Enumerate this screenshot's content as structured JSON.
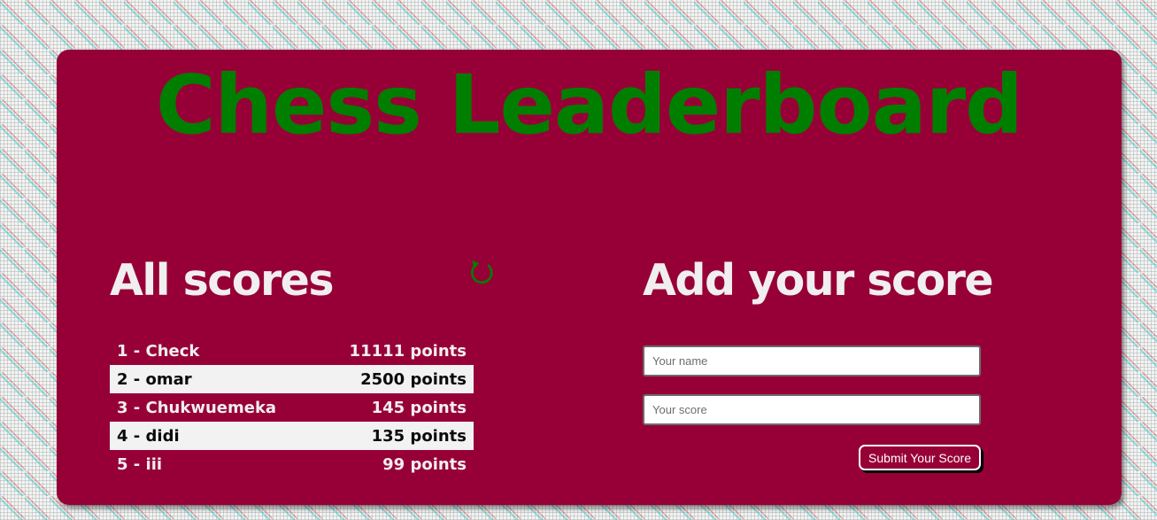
{
  "page": {
    "title": "Chess Leaderboard"
  },
  "scores": {
    "heading": "All scores",
    "refresh_icon": "refresh-icon",
    "items": [
      {
        "label": "1 - Check",
        "points": "11111 points"
      },
      {
        "label": "2 - omar",
        "points": "2500 points"
      },
      {
        "label": "3 - Chukwuemeka",
        "points": "145 points"
      },
      {
        "label": "4 - didi",
        "points": "135 points"
      },
      {
        "label": "5 - iii",
        "points": "99 points"
      }
    ]
  },
  "form": {
    "heading": "Add your score",
    "name_placeholder": "Your name",
    "name_value": "",
    "score_placeholder": "Your score",
    "score_value": "",
    "submit_label": "Submit Your Score"
  },
  "colors": {
    "card_background": "#970036",
    "title_color": "#007e00",
    "heading_color": "#f1eef0",
    "alt_row_background": "#f2f2f2"
  }
}
